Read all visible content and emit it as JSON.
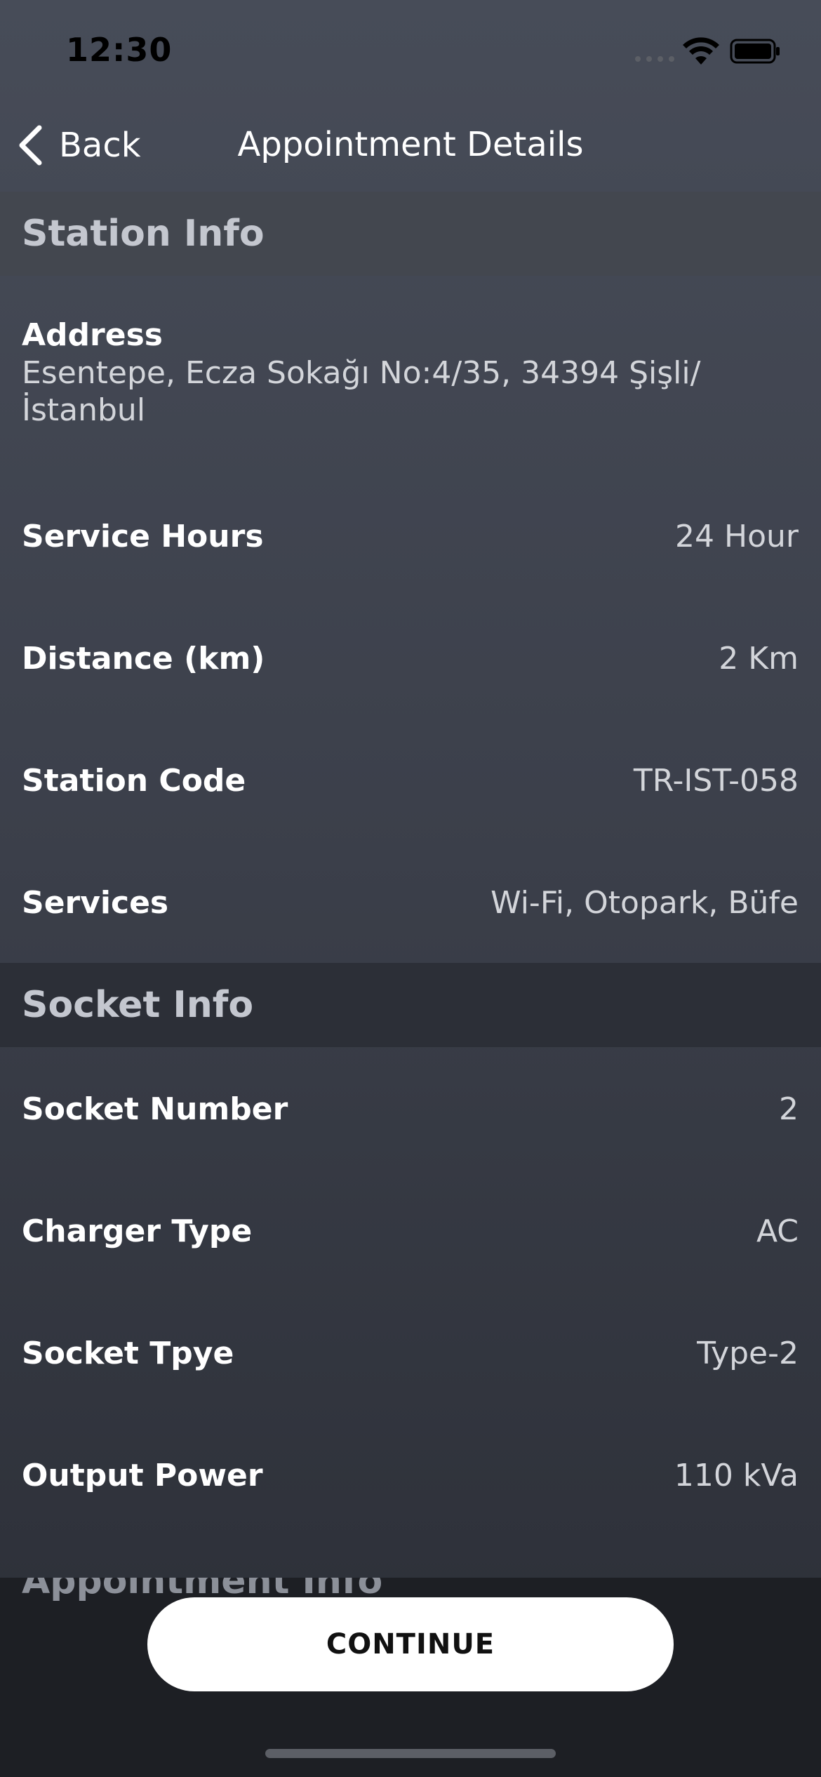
{
  "status": {
    "time": "12:30"
  },
  "nav": {
    "back_label": "Back",
    "title": "Appointment Details"
  },
  "station_info": {
    "header": "Station Info",
    "address_label": "Address",
    "address_value": "Esentepe, Ecza Sokağı No:4/35, 34394 Şişli/İstanbul",
    "rows": [
      {
        "label": "Service Hours",
        "value": "24 Hour"
      },
      {
        "label": "Distance (km)",
        "value": "2 Km"
      },
      {
        "label": "Station Code",
        "value": "TR-IST-058"
      },
      {
        "label": "Services",
        "value": "Wi-Fi, Otopark, Büfe"
      }
    ]
  },
  "socket_info": {
    "header": "Socket Info",
    "rows": [
      {
        "label": "Socket Number",
        "value": "2"
      },
      {
        "label": "Charger Type",
        "value": "AC"
      },
      {
        "label": "Socket Tpye",
        "value": "Type-2"
      },
      {
        "label": "Output Power",
        "value": "110 kVa"
      }
    ]
  },
  "appointment_info": {
    "header": "Appointment Info"
  },
  "actions": {
    "continue_label": "CONTINUE"
  },
  "icons": {
    "back": "chevron-left-icon",
    "wifi": "wifi-icon",
    "battery": "battery-icon",
    "signal": "signal-icon"
  },
  "colors": {
    "button_bg": "#ffffff",
    "button_text": "#111111",
    "panel_bg": "#1d1f24",
    "section_header_text": "#c4c7cf"
  }
}
